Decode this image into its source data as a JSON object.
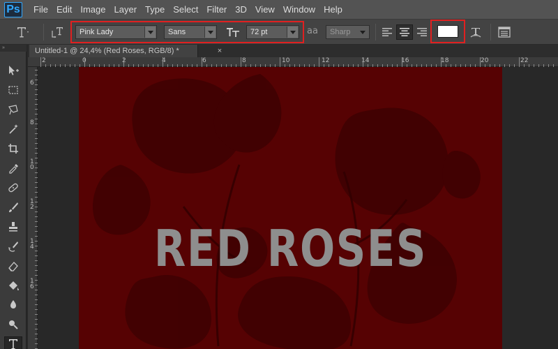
{
  "app": {
    "logo": "Ps"
  },
  "menu": [
    "File",
    "Edit",
    "Image",
    "Layer",
    "Type",
    "Select",
    "Filter",
    "3D",
    "View",
    "Window",
    "Help"
  ],
  "options_bar": {
    "tool_icon": "type-tool-icon",
    "font_family": "Pink Lady",
    "font_style": "Sans",
    "font_size": "72 pt",
    "aa_label": "aa",
    "antialias": "Sharp",
    "text_color": "#ffffff"
  },
  "document_tab": {
    "title": "Untitled-1 @ 24,4% (Red Roses, RGB/8) *",
    "close": "×"
  },
  "toolbar_top": "»",
  "ruler_top_labels": [
    "2",
    "0",
    "2",
    "4",
    "6",
    "8",
    "10",
    "12",
    "14",
    "16",
    "18",
    "20",
    "22"
  ],
  "ruler_left_labels": [
    "6",
    "8",
    "10",
    "12",
    "14",
    "16"
  ],
  "canvas": {
    "text": "RED ROSES",
    "background": "#560203",
    "text_color": "#8e8e8e"
  },
  "colors": {
    "highlight": "#e02020",
    "accent": "#31a8ff"
  }
}
